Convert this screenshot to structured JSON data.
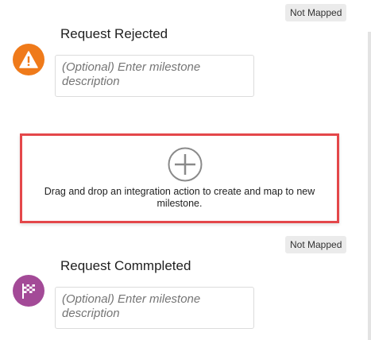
{
  "milestones": [
    {
      "badge": "Not Mapped",
      "title": "Request Rejected",
      "icon": "warning-icon",
      "icon_color": "#ef7a1a",
      "description_placeholder": "(Optional) Enter milestone description"
    },
    {
      "badge": "Not Mapped",
      "title": "Request Commpleted",
      "icon": "checkered-flag-icon",
      "icon_color": "#a34a97",
      "description_placeholder": "(Optional) Enter milestone description"
    }
  ],
  "drop_zone": {
    "icon": "add-circle-icon",
    "text": "Drag and drop an integration action to create and map to new milestone.",
    "border_color": "#e4474a"
  }
}
